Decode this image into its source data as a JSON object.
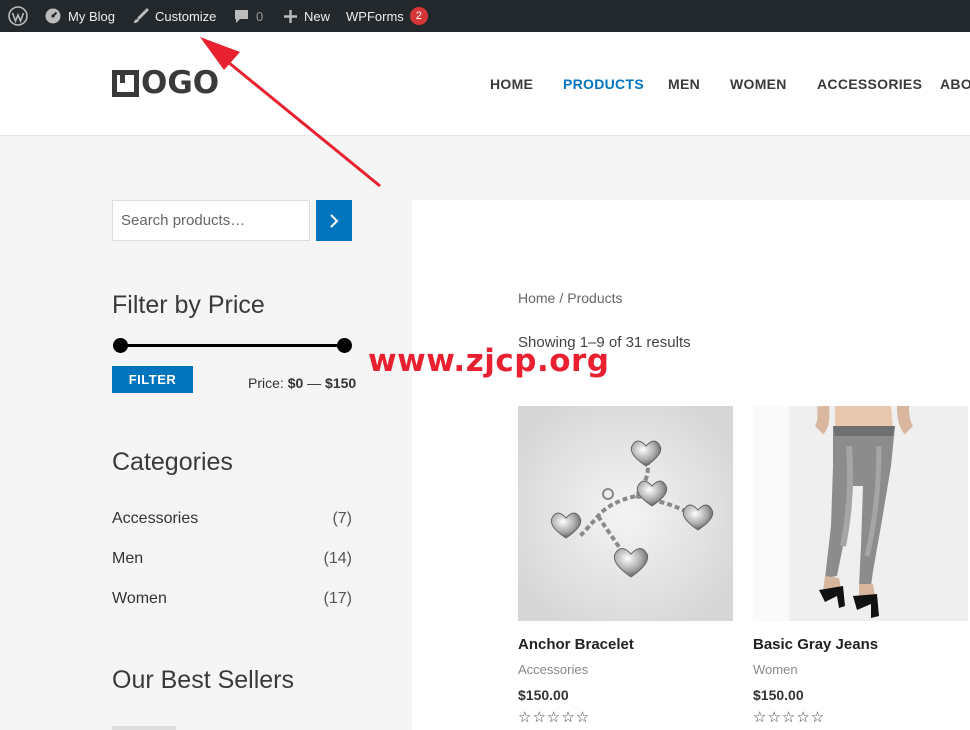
{
  "admin_bar": {
    "wp_icon": "wordpress-icon",
    "site_name": "My Blog",
    "customize": "Customize",
    "comments_count": "0",
    "new_label": "New",
    "wpforms_label": "WPForms",
    "wpforms_badge": "2"
  },
  "header": {
    "logo_text": "OGO",
    "nav": [
      "HOME",
      "PRODUCTS",
      "MEN",
      "WOMEN",
      "ACCESSORIES",
      "ABO"
    ],
    "active_nav": "PRODUCTS"
  },
  "sidebar": {
    "search_placeholder": "Search products…",
    "filter_title": "Filter by Price",
    "filter_button": "FILTER",
    "price_prefix": "Price: ",
    "price_min": "$0",
    "price_sep": " — ",
    "price_max": "$150",
    "price_range": [
      0,
      150
    ],
    "categories_title": "Categories",
    "categories": [
      {
        "name": "Accessories",
        "count": "(7)"
      },
      {
        "name": "Men",
        "count": "(14)"
      },
      {
        "name": "Women",
        "count": "(17)"
      }
    ],
    "best_sellers_title": "Our Best Sellers"
  },
  "main": {
    "breadcrumb_home": "Home",
    "breadcrumb_sep": "/",
    "breadcrumb_current": "Products",
    "results": "Showing 1–9 of 31 results",
    "products": [
      {
        "title": "Anchor Bracelet",
        "category": "Accessories",
        "price": "$150.00",
        "rating": 0,
        "stars": "☆☆☆☆☆"
      },
      {
        "title": "Basic Gray Jeans",
        "category": "Women",
        "price": "$150.00",
        "rating": 0,
        "stars": "☆☆☆☆☆"
      }
    ]
  },
  "overlay": {
    "watermark": "www.zjcp.org",
    "arrow_color": "#e8202f"
  },
  "colors": {
    "accent": "#0274be",
    "admin_bar": "#23282d",
    "badge": "#d63638"
  }
}
